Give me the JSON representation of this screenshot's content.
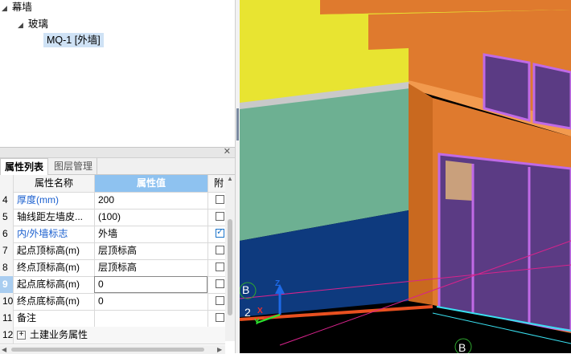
{
  "tree": {
    "root": "幕墙",
    "child": "玻璃",
    "leaf": "MQ-1 [外墙]"
  },
  "panel": {
    "close_icon": "close-icon",
    "tabs": [
      "属性列表",
      "图层管理"
    ],
    "headers": {
      "name": "属性名称",
      "value": "属性值",
      "attach": "附"
    },
    "rows": [
      {
        "num": "4",
        "name": "厚度(mm)",
        "value": "200",
        "checked": false
      },
      {
        "num": "5",
        "name": "轴线距左墙皮...",
        "value": "(100)",
        "checked": false
      },
      {
        "num": "6",
        "name": "内/外墙标志",
        "value": "外墙",
        "checked": true
      },
      {
        "num": "7",
        "name": "起点顶标高(m)",
        "value": "层顶标高",
        "checked": false
      },
      {
        "num": "8",
        "name": "终点顶标高(m)",
        "value": "层顶标高",
        "checked": false
      },
      {
        "num": "9",
        "name": "起点底标高(m)",
        "value": "0",
        "checked": false
      },
      {
        "num": "10",
        "name": "终点底标高(m)",
        "value": "0",
        "checked": false
      },
      {
        "num": "11",
        "name": "备注",
        "value": "",
        "checked": false
      },
      {
        "num": "12",
        "name": "土建业务属性",
        "value": "",
        "checked": false
      }
    ]
  },
  "viewport": {
    "axis_labels": {
      "b_top": "B",
      "two": "2",
      "b_bottom": "B",
      "z": "Z",
      "x": "X",
      "y": "Y"
    },
    "colors": {
      "wall_yellow": "#e8e431",
      "wall_orange": "#df7a2e",
      "curtain_green": "#6db092",
      "glass_blue": "#0e3a7e",
      "glass_purple": "#5b3b84",
      "frame_violet": "#c06ae6"
    }
  }
}
